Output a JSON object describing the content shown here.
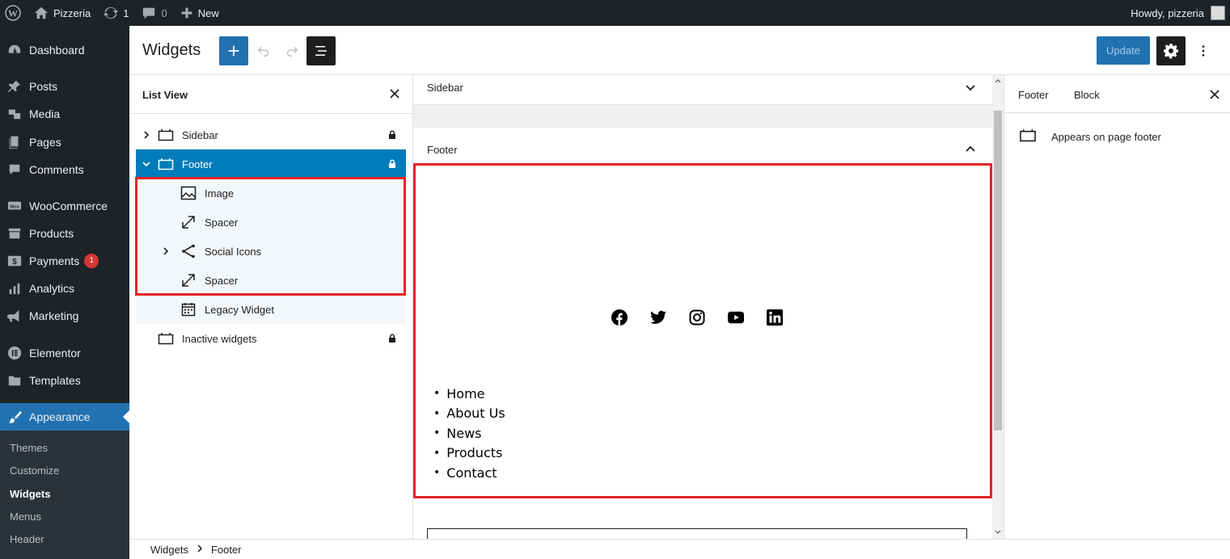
{
  "adminbar": {
    "site_name": "Pizzeria",
    "updates_count": "1",
    "comments_count": "0",
    "new_label": "New",
    "greeting": "Howdy, pizzeria"
  },
  "menu": {
    "dashboard": "Dashboard",
    "posts": "Posts",
    "media": "Media",
    "pages": "Pages",
    "comments": "Comments",
    "woocommerce": "WooCommerce",
    "products": "Products",
    "payments": "Payments",
    "payments_badge": "1",
    "analytics": "Analytics",
    "marketing": "Marketing",
    "elementor": "Elementor",
    "templates": "Templates",
    "appearance": "Appearance",
    "submenu": {
      "themes": "Themes",
      "customize": "Customize",
      "widgets": "Widgets",
      "menus": "Menus",
      "header": "Header"
    }
  },
  "editor": {
    "title": "Widgets",
    "update_label": "Update"
  },
  "listview": {
    "title": "List View",
    "items": {
      "sidebar": "Sidebar",
      "footer": "Footer",
      "image": "Image",
      "spacer1": "Spacer",
      "social_icons": "Social Icons",
      "spacer2": "Spacer",
      "legacy_widget": "Legacy Widget",
      "inactive": "Inactive widgets"
    }
  },
  "canvas": {
    "sidebar_area": "Sidebar",
    "footer_area": "Footer",
    "nav_links": [
      "Home",
      "About Us",
      "News",
      "Products",
      "Contact"
    ]
  },
  "settings": {
    "tab_footer": "Footer",
    "tab_block": "Block",
    "description": "Appears on page footer"
  },
  "breadcrumb": {
    "root": "Widgets",
    "current": "Footer"
  },
  "colors": {
    "admin_dark": "#1d2327",
    "accent": "#2271b1",
    "selected": "#007cba",
    "highlight": "#e5232a"
  }
}
